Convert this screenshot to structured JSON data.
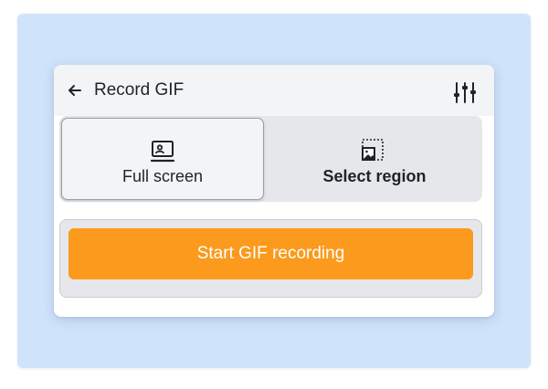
{
  "header": {
    "title": "Record GIF",
    "back_icon": "arrow-left-icon",
    "settings_icon": "sliders-icon"
  },
  "modes": [
    {
      "label": "Full screen",
      "icon": "screen-capture-icon",
      "selected": true
    },
    {
      "label": "Select region",
      "icon": "region-select-icon",
      "selected": false
    }
  ],
  "action": {
    "start_label": "Start GIF recording"
  },
  "colors": {
    "backdrop": "#cfe3fb",
    "accent": "#fb9a1d",
    "surface": "#e5e7eb"
  }
}
